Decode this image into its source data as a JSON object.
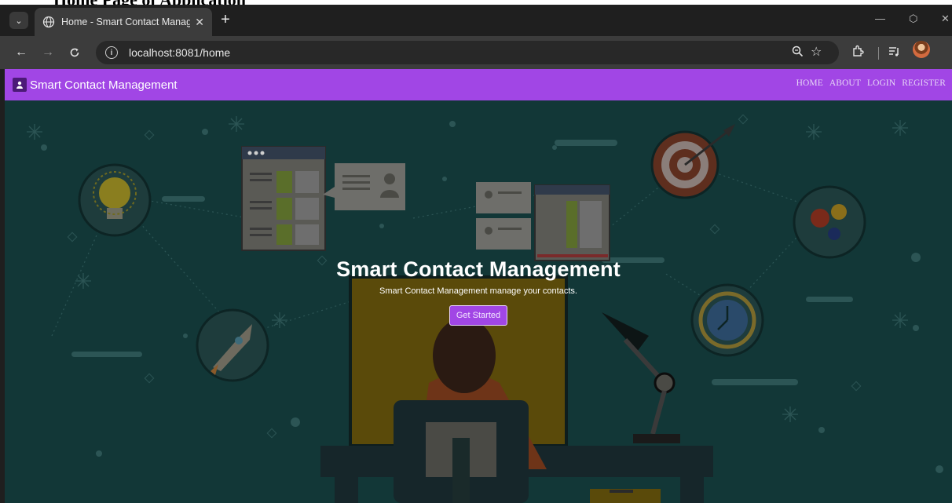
{
  "caption": "Home Page of Application",
  "browser": {
    "tab": {
      "title": "Home - Smart Contact Manage",
      "close_glyph": "✕"
    },
    "new_tab_glyph": "+",
    "url": "localhost:8081/home",
    "window_controls": {
      "minimize": "—",
      "restore": "⬡",
      "close": "✕"
    },
    "icons": [
      "tab-search-icon",
      "globe-icon",
      "back-icon",
      "forward-icon",
      "reload-icon",
      "site-info-icon",
      "zoom-icon",
      "star-icon",
      "extensions-icon",
      "reading-list-icon",
      "profile-avatar"
    ]
  },
  "site": {
    "brand": "Smart Contact Management",
    "nav": [
      "HOME",
      "ABOUT",
      "LOGIN",
      "REGISTER"
    ],
    "hero": {
      "title": "Smart Contact Management",
      "subtitle": "Smart Contact Management manage your contacts.",
      "cta": "Get Started"
    }
  },
  "colors": {
    "navbar": "#a146e5",
    "hero_bg": "#123737",
    "cta": "#a146e5",
    "browser_chrome": "#3c3c3c"
  }
}
